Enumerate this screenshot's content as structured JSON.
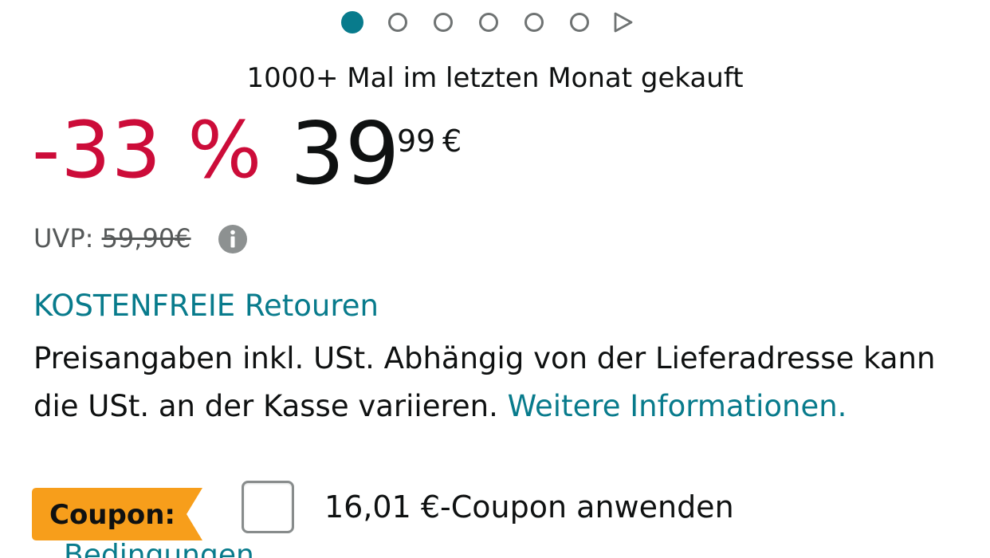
{
  "carousel": {
    "dot_count": 6,
    "active_index": 0,
    "active_color": "#087b8c",
    "play_icon": "play-icon"
  },
  "social_proof": "1000+ Mal im letzten Monat gekauft",
  "price": {
    "discount": "-33 %",
    "whole": "39",
    "fraction": "99",
    "currency": "€",
    "discount_color": "#cc0c39"
  },
  "uvp": {
    "label": "UVP:",
    "value": "59,90€",
    "info_icon": "info-icon"
  },
  "returns_link": "KOSTENFREIE Retouren",
  "tax_note": {
    "text": "Preisangaben inkl. USt. Abhängig von der Lieferadresse kann die USt. an der Kasse variieren.",
    "link": "Weitere Informationen."
  },
  "coupon": {
    "badge_label": "Coupon:",
    "badge_color": "#f79e1b",
    "checkbox_checked": false,
    "apply_text": "16,01 €-Coupon anwenden",
    "terms_link": "Bedingungen"
  }
}
